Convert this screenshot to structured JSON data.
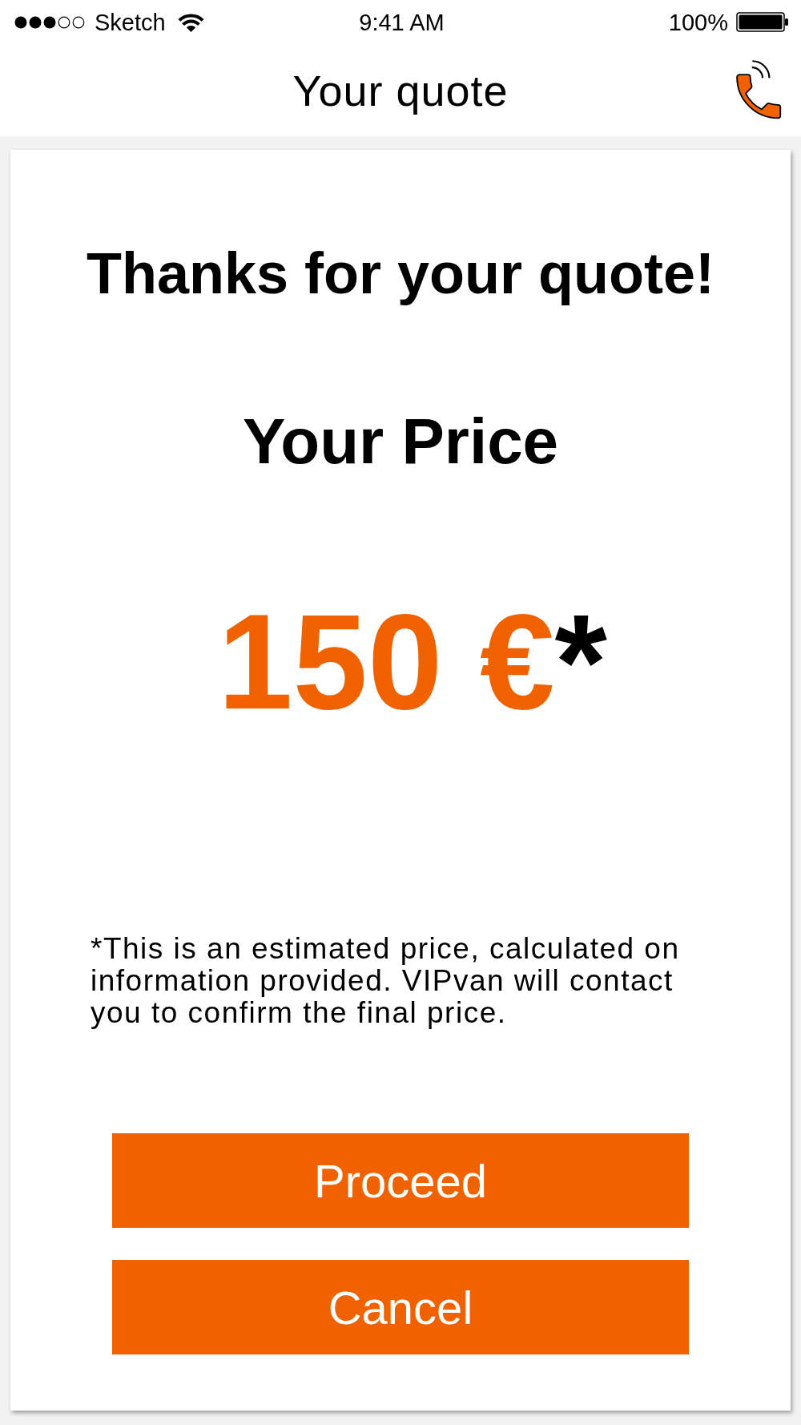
{
  "status_bar": {
    "carrier": "Sketch",
    "time": "9:41 AM",
    "battery": "100%"
  },
  "nav_bar": {
    "title": "Your quote"
  },
  "card": {
    "heading": "Thanks for your quote!",
    "price_label": "Your Price",
    "price": "150 €",
    "price_mark": "*",
    "note": "*This is an estimated price, calculated on information provided. VIPvan will contact you to confirm the final price."
  },
  "buttons": [
    {
      "label": "Proceed"
    },
    {
      "label": "Cancel"
    }
  ]
}
